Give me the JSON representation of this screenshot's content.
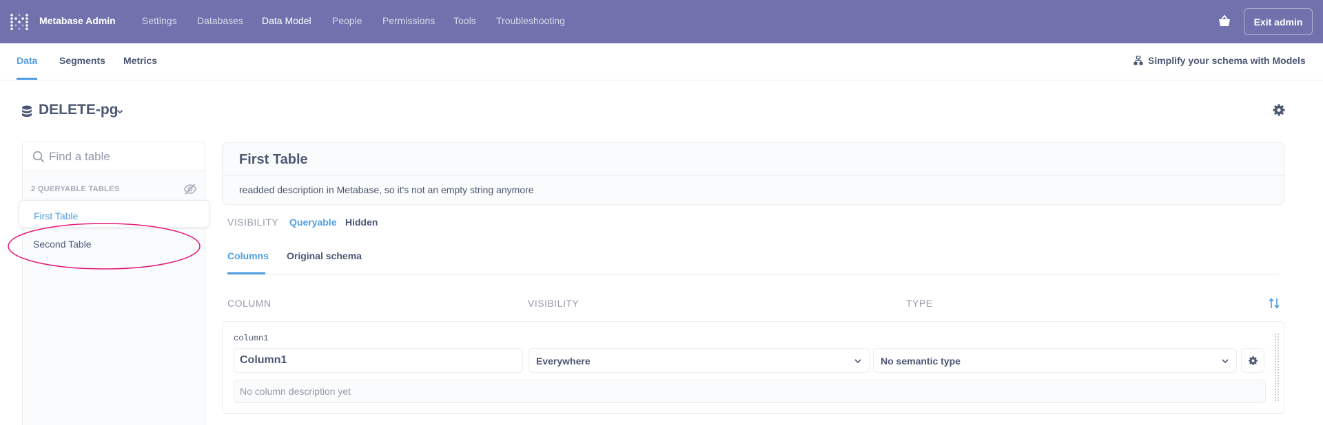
{
  "topnav": {
    "brand": "Metabase Admin",
    "items": [
      "Settings",
      "Databases",
      "Data Model",
      "People",
      "Permissions",
      "Tools",
      "Troubleshooting"
    ],
    "active": "Data Model",
    "exit_label": "Exit admin"
  },
  "subnav": {
    "tabs": [
      "Data",
      "Segments",
      "Metrics"
    ],
    "active": "Data",
    "models_link": "Simplify your schema with Models"
  },
  "database": {
    "name": "DELETE-pg"
  },
  "sidebar": {
    "search_placeholder": "Find a table",
    "queryable_label": "2 QUERYABLE TABLES",
    "tables": [
      "First Table",
      "Second Table"
    ],
    "selected": "First Table"
  },
  "table": {
    "title": "First Table",
    "description": "readded description in Metabase, so it's not an empty string anymore",
    "visibility_label": "VISIBILITY",
    "visibility_options": [
      "Queryable",
      "Hidden"
    ],
    "visibility_active": "Queryable",
    "tabs": [
      "Columns",
      "Original schema"
    ],
    "tab_active": "Columns"
  },
  "columns_header": {
    "column": "COLUMN",
    "visibility": "VISIBILITY",
    "type": "TYPE"
  },
  "columns": [
    {
      "raw_name": "column1",
      "display_name": "Column1",
      "visibility": "Everywhere",
      "semantic_type": "No semantic type",
      "description_placeholder": "No column description yet"
    }
  ],
  "colors": {
    "nav_bg": "#7172ad",
    "accent": "#509ee3",
    "text": "#4c5773",
    "highlight": "#e5157a"
  }
}
